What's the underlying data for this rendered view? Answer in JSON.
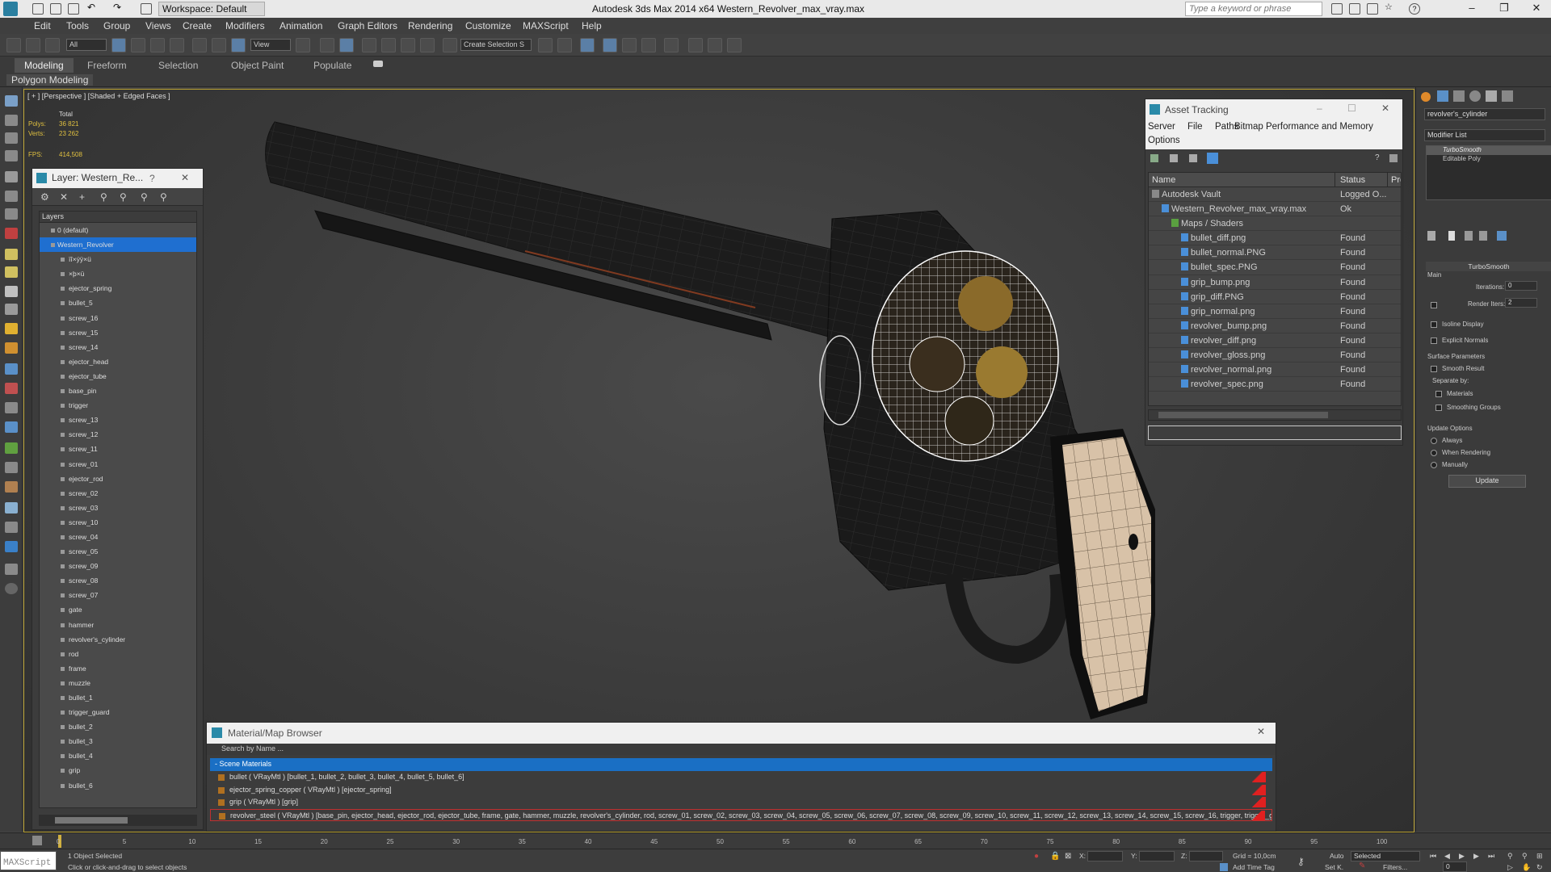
{
  "titlebar": {
    "workspace": "Workspace: Default",
    "title": "Autodesk 3ds Max  2014 x64     Western_Revolver_max_vray.max",
    "search_placeholder": "Type a keyword or phrase"
  },
  "menu": [
    "Edit",
    "Tools",
    "Group",
    "Views",
    "Create",
    "Modifiers",
    "Animation",
    "Graph Editors",
    "Rendering",
    "Customize",
    "MAXScript",
    "Help"
  ],
  "toolbar": {
    "filter": "All",
    "refcoord": "View",
    "selection_set": "Create Selection S"
  },
  "ribbon": {
    "tabs": [
      "Modeling",
      "Freeform",
      "Selection",
      "Object Paint",
      "Populate"
    ],
    "active_tab": "Modeling",
    "subtab": "Polygon Modeling"
  },
  "viewport": {
    "label": "[ + ] [Perspective ] [Shaded + Edged Faces ]",
    "stats_header": "Total",
    "polys_label": "Polys:",
    "polys_value": "36 821",
    "verts_label": "Verts:",
    "verts_value": "23 262",
    "fps_label": "FPS:",
    "fps_value": "414,508"
  },
  "layer_panel": {
    "title": "Layer: Western_Re...",
    "help": "?",
    "column_header": "Layers",
    "layers": [
      {
        "name": "0 (default)",
        "level": 1
      },
      {
        "name": "Western_Revolver",
        "level": 1,
        "selected": true
      },
      {
        "name": "ïî×ýÿ×ü",
        "level": 2
      },
      {
        "name": "×þ×ü",
        "level": 2
      },
      {
        "name": "ejector_spring",
        "level": 2
      },
      {
        "name": "bullet_5",
        "level": 2
      },
      {
        "name": "screw_16",
        "level": 2
      },
      {
        "name": "screw_15",
        "level": 2
      },
      {
        "name": "screw_14",
        "level": 2
      },
      {
        "name": "ejector_head",
        "level": 2
      },
      {
        "name": "ejector_tube",
        "level": 2
      },
      {
        "name": "base_pin",
        "level": 2
      },
      {
        "name": "trigger",
        "level": 2
      },
      {
        "name": "screw_13",
        "level": 2
      },
      {
        "name": "screw_12",
        "level": 2
      },
      {
        "name": "screw_11",
        "level": 2
      },
      {
        "name": "screw_01",
        "level": 2
      },
      {
        "name": "ejector_rod",
        "level": 2
      },
      {
        "name": "screw_02",
        "level": 2
      },
      {
        "name": "screw_03",
        "level": 2
      },
      {
        "name": "screw_10",
        "level": 2
      },
      {
        "name": "screw_04",
        "level": 2
      },
      {
        "name": "screw_05",
        "level": 2
      },
      {
        "name": "screw_09",
        "level": 2
      },
      {
        "name": "screw_08",
        "level": 2
      },
      {
        "name": "screw_07",
        "level": 2
      },
      {
        "name": "gate",
        "level": 2
      },
      {
        "name": "hammer",
        "level": 2
      },
      {
        "name": "revolver's_cylinder",
        "level": 2
      },
      {
        "name": "rod",
        "level": 2
      },
      {
        "name": "frame",
        "level": 2
      },
      {
        "name": "muzzle",
        "level": 2
      },
      {
        "name": "bullet_1",
        "level": 2
      },
      {
        "name": "trigger_guard",
        "level": 2
      },
      {
        "name": "bullet_2",
        "level": 2
      },
      {
        "name": "bullet_3",
        "level": 2
      },
      {
        "name": "bullet_4",
        "level": 2
      },
      {
        "name": "grip",
        "level": 2
      },
      {
        "name": "bullet_6",
        "level": 2
      }
    ]
  },
  "asset_tracking": {
    "title": "Asset Tracking",
    "menu": [
      "Server",
      "File",
      "Paths",
      "Bitmap Performance and Memory",
      "Options"
    ],
    "columns": [
      "Name",
      "Status",
      "Pro"
    ],
    "rows": [
      {
        "name": "Autodesk Vault",
        "status": "Logged O...",
        "indent": 0
      },
      {
        "name": "Western_Revolver_max_vray.max",
        "status": "Ok",
        "indent": 1
      },
      {
        "name": "Maps / Shaders",
        "status": "",
        "indent": 2
      },
      {
        "name": "bullet_diff.png",
        "status": "Found",
        "indent": 3
      },
      {
        "name": "bullet_normal.PNG",
        "status": "Found",
        "indent": 3
      },
      {
        "name": "bullet_spec.PNG",
        "status": "Found",
        "indent": 3
      },
      {
        "name": "grip_bump.png",
        "status": "Found",
        "indent": 3
      },
      {
        "name": "grip_diff.PNG",
        "status": "Found",
        "indent": 3
      },
      {
        "name": "grip_normal.png",
        "status": "Found",
        "indent": 3
      },
      {
        "name": "revolver_bump.png",
        "status": "Found",
        "indent": 3
      },
      {
        "name": "revolver_diff.png",
        "status": "Found",
        "indent": 3
      },
      {
        "name": "revolver_gloss.png",
        "status": "Found",
        "indent": 3
      },
      {
        "name": "revolver_normal.png",
        "status": "Found",
        "indent": 3
      },
      {
        "name": "revolver_spec.png",
        "status": "Found",
        "indent": 3
      }
    ]
  },
  "material_browser": {
    "title": "Material/Map Browser",
    "search_placeholder": "Search by Name ...",
    "group": "- Scene Materials",
    "rows": [
      "bullet  ( VRayMtl ) [bullet_1, bullet_2, bullet_3, bullet_4, bullet_5, bullet_6]",
      "ejector_spring_copper  ( VRayMtl ) [ejector_spring]",
      "grip  ( VRayMtl ) [grip]",
      "revolver_steel  ( VRayMtl )  [base_pin, ejector_head, ejector_rod, ejector_tube, frame, gate, hammer, muzzle, revolver's_cylinder, rod, screw_01, screw_02, screw_03, screw_04, screw_05, screw_06, screw_07, screw_08, screw_09, screw_10, screw_11, screw_12, screw_13, screw_14, screw_15, screw_16, trigger, trigger_guard]"
    ]
  },
  "command_panel": {
    "object_name": "revolver's_cylinder",
    "modifier_list": "Modifier List",
    "stack": [
      "TurboSmooth",
      "Editable Poly"
    ],
    "rollout_title": "TurboSmooth",
    "main_label": "Main",
    "iterations_label": "Iterations:",
    "iterations_value": "0",
    "render_iters_label": "Render Iters:",
    "render_iters_value": "2",
    "isoline": "Isoline Display",
    "explicit": "Explicit Normals",
    "surface_params": "Surface Parameters",
    "smooth_result": "Smooth Result",
    "separate_by": "Separate by:",
    "materials": "Materials",
    "smoothing_groups": "Smoothing Groups",
    "update_options": "Update Options",
    "always": "Always",
    "when_rendering": "When Rendering",
    "manually": "Manually",
    "update_button": "Update"
  },
  "timeline": {
    "ticks": [
      "0",
      "5",
      "10",
      "15",
      "20",
      "25",
      "30",
      "35",
      "40",
      "45",
      "50",
      "55",
      "60",
      "65",
      "70",
      "75",
      "80",
      "85",
      "90",
      "95",
      "100"
    ]
  },
  "statusbar": {
    "maxscript": "MAXScript",
    "selected": "1 Object Selected",
    "hint": "Click or click-and-drag to select objects",
    "x_label": "X:",
    "y_label": "Y:",
    "z_label": "Z:",
    "grid": "Grid = 10,0cm",
    "auto": "Auto",
    "selected_dropdown": "Selected",
    "set_key": "Set K.",
    "filters": "Filters...",
    "add_time_tag": "Add Time Tag",
    "frame": "0"
  }
}
